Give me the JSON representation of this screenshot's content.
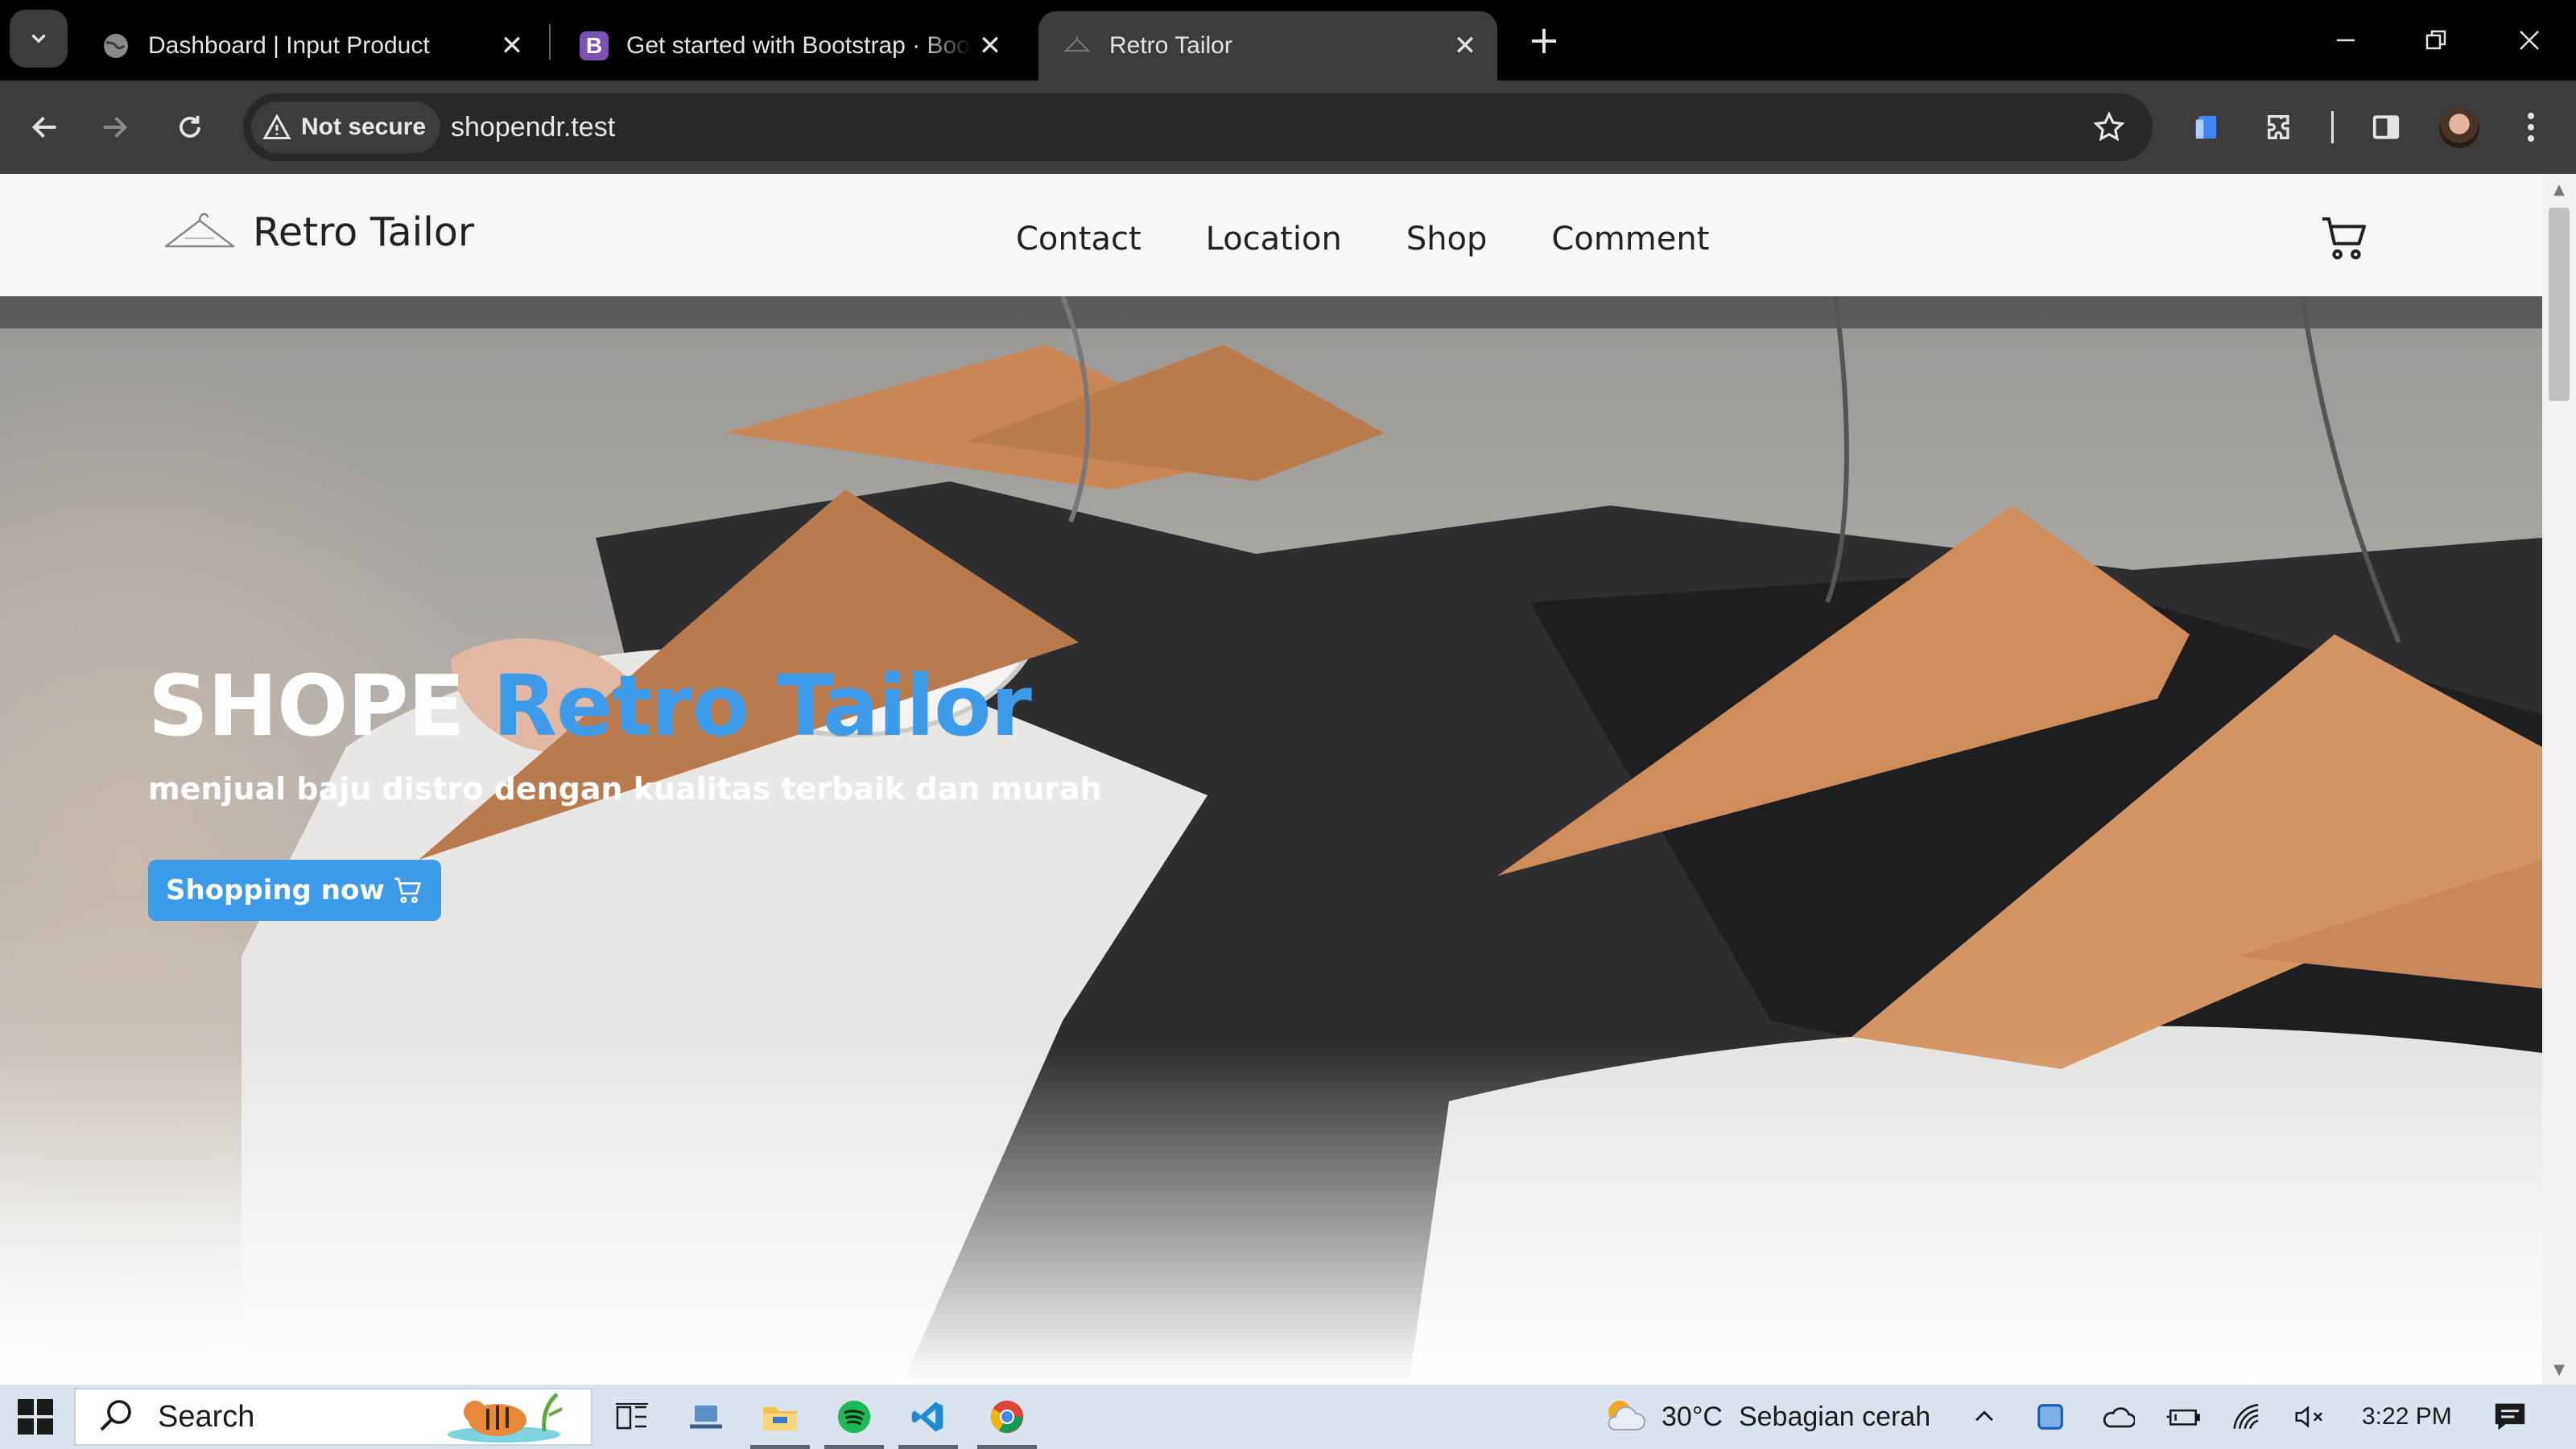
{
  "browser": {
    "tabs": [
      {
        "title": "Dashboard | Input Product",
        "favicon": "globe-icon",
        "active": false
      },
      {
        "title": "Get started with Bootstrap · Bootstrap",
        "favicon": "bootstrap-icon",
        "active": false
      },
      {
        "title": "Retro Tailor",
        "favicon": "hanger-icon",
        "active": true
      }
    ],
    "security_label": "Not secure",
    "url": "shopendr.test"
  },
  "site": {
    "brand": "Retro Tailor",
    "nav": [
      "Contact",
      "Location",
      "Shop",
      "Comment"
    ],
    "hero": {
      "title_prefix": "SHOPE",
      "title_accent": "Retro Tailor",
      "subtitle": "menjual baju distro dengan kualitas terbaik dan murah",
      "button_label": "Shopping now"
    },
    "colors": {
      "accent": "#3d9be9",
      "nav_bg": "#f7f7f7"
    }
  },
  "taskbar": {
    "search_placeholder": "Search",
    "weather_temp": "30°C",
    "weather_desc": "Sebagian cerah",
    "time": "3:22 PM",
    "pinned_apps": [
      "task-view-icon",
      "laptop-icon",
      "file-explorer-icon",
      "spotify-icon",
      "vscode-icon",
      "chrome-icon"
    ]
  }
}
